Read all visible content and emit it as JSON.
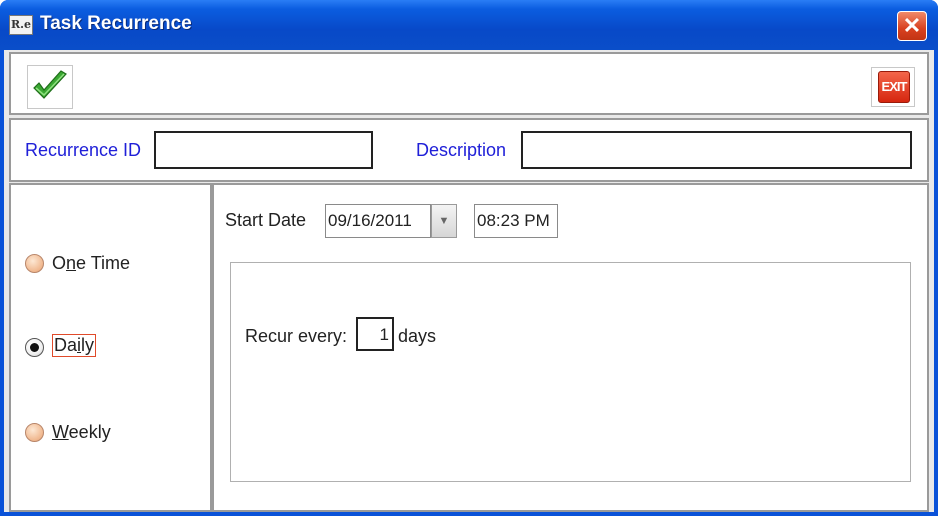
{
  "window": {
    "title": "Task Recurrence",
    "app_icon_text": "R.e"
  },
  "toolbar": {
    "exit_label": "EXIT"
  },
  "form": {
    "recurrence_id_label": "Recurrence ID",
    "recurrence_id_value": "",
    "description_label": "Description",
    "description_value": ""
  },
  "recurrence_types": [
    {
      "label_pre": "O",
      "mnemonic": "n",
      "label_post": "e Time",
      "selected": false
    },
    {
      "label_pre": "Da",
      "mnemonic": "i",
      "label_post": "ly",
      "selected": true
    },
    {
      "label_pre": "",
      "mnemonic": "W",
      "label_post": "eekly",
      "selected": false
    }
  ],
  "schedule": {
    "start_date_label": "Start Date",
    "start_date": "09/16/2011",
    "start_time": "08:23 PM",
    "recur_every_label": "Recur every:",
    "recur_every_value": "1",
    "recur_unit": "days"
  },
  "colors": {
    "title_bar": "#0a4ec9",
    "label_blue": "#2020d8",
    "focus_border": "#e04a2a"
  }
}
